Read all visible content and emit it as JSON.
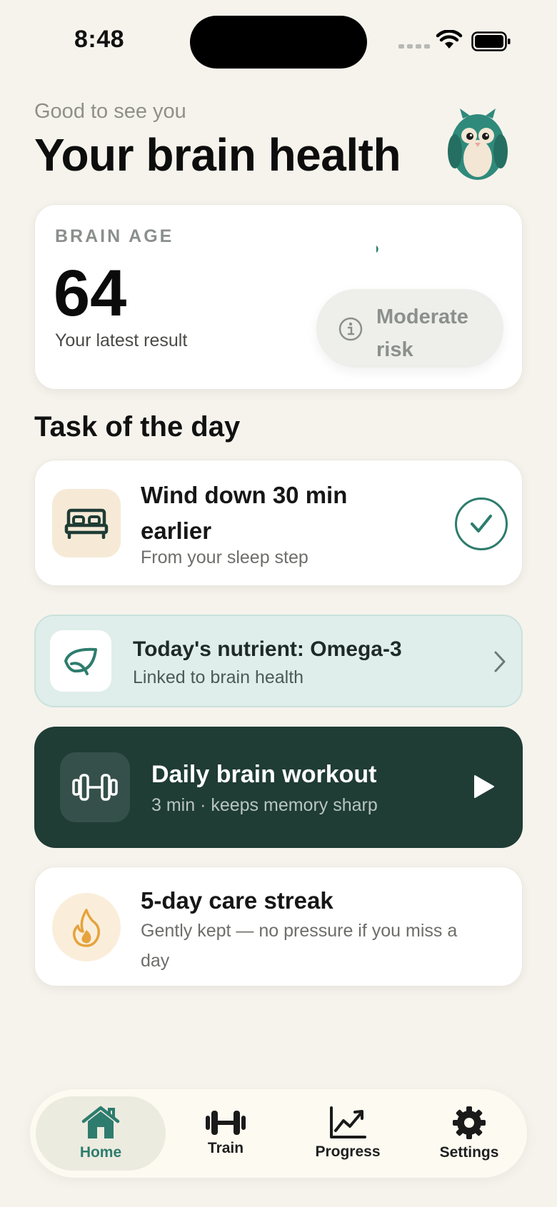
{
  "status_bar": {
    "time": "8:48"
  },
  "header": {
    "greeting": "Good to see you",
    "title": "Your brain health"
  },
  "brain_age": {
    "label": "BRAIN AGE",
    "value": "64",
    "subtitle": "Your latest result",
    "risk": "Moderate risk"
  },
  "section": {
    "title": "Task of the day"
  },
  "task": {
    "title": "Wind down 30 min earlier",
    "subtitle": "From your sleep step",
    "icon": "bed-icon",
    "completed": true
  },
  "nutrient": {
    "title": "Today's nutrient: Omega-3",
    "subtitle": "Linked to brain health",
    "icon": "leaf-icon"
  },
  "workout": {
    "title": "Daily brain workout",
    "subtitle": "3 min · keeps memory sharp",
    "icon": "dumbbell-icon"
  },
  "streak": {
    "title": "5-day care streak",
    "subtitle": "Gently kept — no pressure if you miss a day",
    "icon": "flame-icon"
  },
  "tabs": [
    {
      "label": "Home",
      "icon": "home-icon",
      "active": true
    },
    {
      "label": "Train",
      "icon": "dumbbell-icon",
      "active": false
    },
    {
      "label": "Progress",
      "icon": "chart-icon",
      "active": false
    },
    {
      "label": "Settings",
      "icon": "gear-icon",
      "active": false
    }
  ],
  "colors": {
    "background": "#f6f3ec",
    "accent": "#2e7c6e",
    "dark_card": "#1f3c35",
    "nutrient_card": "#dfeeea",
    "task_icon_bg": "#f6ead7",
    "streak_flame": "#e6a23c"
  }
}
